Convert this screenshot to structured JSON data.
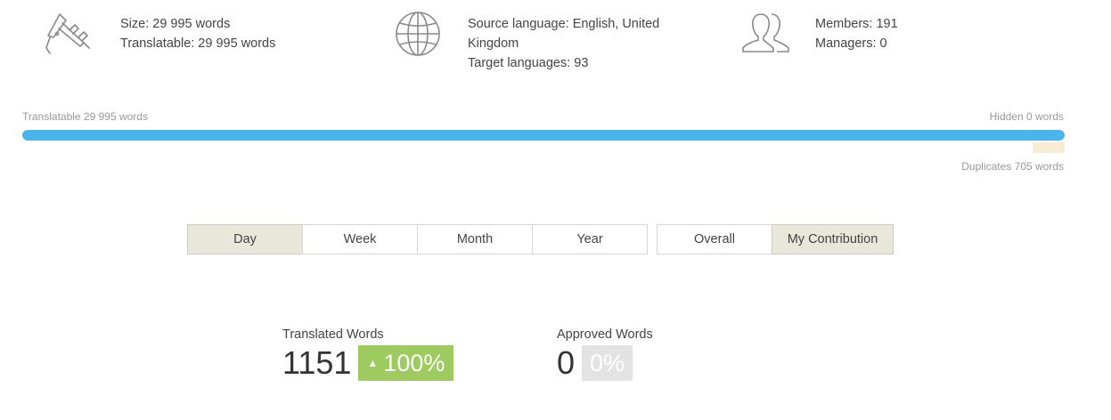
{
  "stats": {
    "size": {
      "icon": "caliper-icon",
      "size_text": "Size: 29 995 words",
      "translatable_text": "Translatable: 29 995 words"
    },
    "languages": {
      "icon": "globe-icon",
      "source_text": "Source language: English, United Kingdom",
      "target_text": "Target languages: 93"
    },
    "members": {
      "icon": "users-icon",
      "members_text": "Members: 191",
      "managers_text": "Managers: 0"
    }
  },
  "wordbar": {
    "translatable_label": "Translatable 29 995 words",
    "hidden_label": "Hidden 0 words",
    "duplicates_label": "Duplicates 705 words",
    "translatable_fraction": 1.0,
    "duplicates_fraction": 0.0235,
    "bar_color": "#4ab4ec",
    "duplicates_color": "#f7ecd2"
  },
  "period_tabs": [
    {
      "label": "Day",
      "active": true
    },
    {
      "label": "Week",
      "active": false
    },
    {
      "label": "Month",
      "active": false
    },
    {
      "label": "Year",
      "active": false
    }
  ],
  "scope_tabs": [
    {
      "label": "Overall",
      "active": false
    },
    {
      "label": "My Contribution",
      "active": true
    }
  ],
  "metrics": {
    "translated": {
      "label": "Translated Words",
      "value": "1151",
      "change": "100%",
      "badge_color": "#9ecb5f",
      "arrow": "up-arrow-icon"
    },
    "approved": {
      "label": "Approved Words",
      "value": "0",
      "change": "0%",
      "badge_color": "#e3e3e3"
    }
  }
}
